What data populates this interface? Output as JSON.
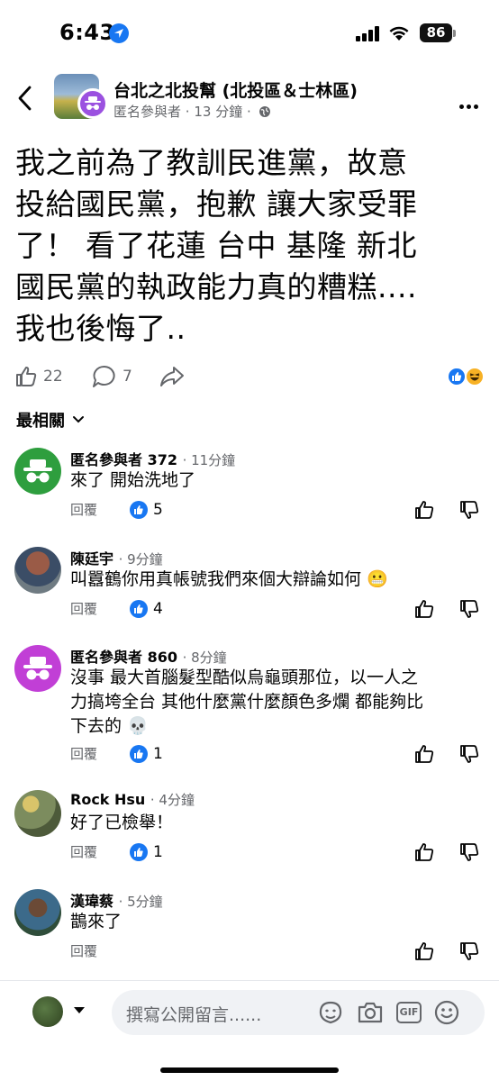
{
  "status_bar": {
    "time": "6:43",
    "battery": "86"
  },
  "header": {
    "group_name": "台北之北投幫 (北投區＆士林區)",
    "author": "匿名參與者",
    "separator": "·",
    "time": "13 分鐘",
    "icons": [
      "back-arrow-icon",
      "globe-icon",
      "more-icon"
    ]
  },
  "post": {
    "lines": [
      "我之前為了教訓民進黨，故意",
      "投給國民黨，抱歉 讓大家受罪",
      "了！  看了花蓮 台中 基隆 新北",
      "國民黨的執政能力真的糟糕....",
      "我也後悔了.."
    ],
    "likes": "22",
    "comments": "7",
    "reaction_icons": [
      "like-icon",
      "haha-icon"
    ]
  },
  "sort_label": "最相關",
  "comments": [
    {
      "name": "匿名參與者 372",
      "time": "· 11分鐘",
      "lines": [
        "來了 開始洗地了"
      ],
      "reply": "回覆",
      "likes": "5",
      "avatar": "anonymous-green"
    },
    {
      "name": "陳廷宇",
      "time": "· 9分鐘",
      "lines": [
        "叫囂鶴你用真帳號我們來個大辯論如何 😬"
      ],
      "reply": "回覆",
      "likes": "4",
      "avatar": "photo"
    },
    {
      "name": "匿名參與者 860",
      "time": "· 8分鐘",
      "lines": [
        "沒事 最大首腦髮型酷似烏龜頭那位，以一人之",
        "力搞垮全台 其他什麼黨什麼顏色多爛 都能夠比",
        "下去的 💀"
      ],
      "reply": "回覆",
      "likes": "1",
      "avatar": "anonymous-purple"
    },
    {
      "name": "Rock Hsu",
      "time": "· 4分鐘",
      "lines": [
        "好了已檢舉！"
      ],
      "reply": "回覆",
      "likes": "1",
      "avatar": "photo"
    },
    {
      "name": "漢瑋蔡",
      "time": "· 5分鐘",
      "lines": [
        "鵲來了"
      ],
      "reply": "回覆",
      "likes": "",
      "avatar": "photo"
    }
  ],
  "composer": {
    "placeholder": "撰寫公開留言......",
    "gif_label": "GIF",
    "icons": [
      "avatar-sticker-icon",
      "camera-icon",
      "gif-icon",
      "emoji-icon"
    ]
  },
  "colors": {
    "accent": "#1877f2",
    "anon_green": "#2e9e3e",
    "anon_purple": "#c13fd6",
    "secondary_text": "#65676b"
  }
}
